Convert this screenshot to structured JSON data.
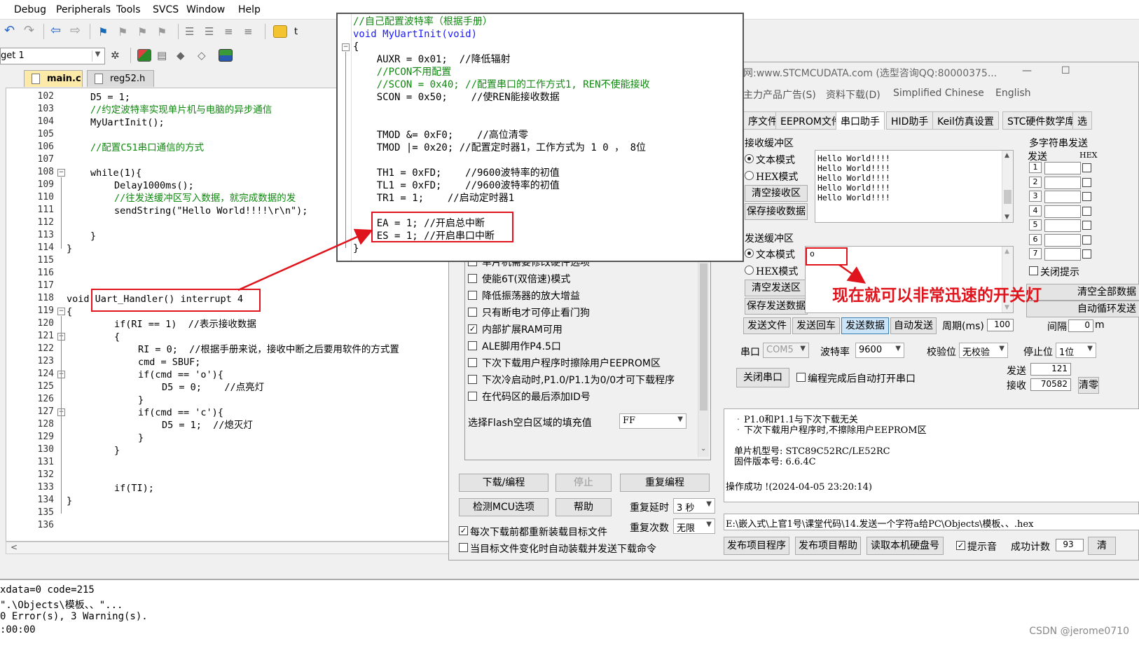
{
  "menu": [
    "Debug",
    "Peripherals",
    "Tools",
    "SVCS",
    "Window",
    "Help"
  ],
  "toolbar": {
    "tail_label": "t"
  },
  "target": {
    "label": "get 1"
  },
  "tabs": [
    "main.c",
    "reg52.h"
  ],
  "editor": {
    "lines": [
      {
        "n": "102",
        "t": "D5 = 1;"
      },
      {
        "n": "103",
        "t": "//约定波特率实现单片机与电脑的异步通信"
      },
      {
        "n": "104",
        "t": "MyUartInit();"
      },
      {
        "n": "105",
        "t": ""
      },
      {
        "n": "106",
        "t": "//配置C51串口通信的方式"
      },
      {
        "n": "107",
        "t": ""
      },
      {
        "n": "108",
        "t": "while(1){"
      },
      {
        "n": "109",
        "t": "Delay1000ms();"
      },
      {
        "n": "110",
        "t": "//往发送缓冲区写入数据，就完成数据的发"
      },
      {
        "n": "111",
        "t": "sendString(\"Hello World!!!!\\r\\n\");"
      },
      {
        "n": "112",
        "t": ""
      },
      {
        "n": "113",
        "t": "}"
      },
      {
        "n": "114",
        "t": "}"
      },
      {
        "n": "115",
        "t": ""
      },
      {
        "n": "116",
        "t": ""
      },
      {
        "n": "117",
        "t": ""
      },
      {
        "n": "118",
        "t": "void Uart_Handler() interrupt 4"
      },
      {
        "n": "119",
        "t": "{"
      },
      {
        "n": "120",
        "t": "if(RI == 1)  //表示接收数据"
      },
      {
        "n": "121",
        "t": "{"
      },
      {
        "n": "122",
        "t": "RI = 0;  //根据手册来说，接收中断之后要用软件的方式置"
      },
      {
        "n": "123",
        "t": "cmd = SBUF;"
      },
      {
        "n": "124",
        "t": "if(cmd == 'o'){"
      },
      {
        "n": "125",
        "t": "D5 = 0;    //点亮灯"
      },
      {
        "n": "126",
        "t": "}"
      },
      {
        "n": "127",
        "t": "if(cmd == 'c'){"
      },
      {
        "n": "128",
        "t": "D5 = 1;  //熄灭灯"
      },
      {
        "n": "129",
        "t": "}"
      },
      {
        "n": "130",
        "t": "}"
      },
      {
        "n": "131",
        "t": ""
      },
      {
        "n": "132",
        "t": ""
      },
      {
        "n": "133",
        "t": "if(TI);"
      },
      {
        "n": "134",
        "t": "}"
      },
      {
        "n": "135",
        "t": ""
      },
      {
        "n": "136",
        "t": ""
      }
    ]
  },
  "output": [
    "xdata=0 code=215",
    "\".\\Objects\\模板、、\"...",
    "0 Error(s), 3 Warning(s).",
    ":00:00"
  ],
  "watermark": "CSDN @jerome0710",
  "popup": {
    "lines": [
      "//自己配置波特率（根据手册）",
      "void MyUartInit(void)",
      "{",
      "    AUXR = 0x01;  //降低辐射",
      "    //PCON不用配置",
      "    //SCON = 0x40; //配置串口的工作方式1, REN不使能接收",
      "    SCON = 0x50;    //使REN能接收数据",
      "",
      "",
      "    TMOD &= 0xF0;    //高位清零",
      "    TMOD |= 0x20; //配置定时器1，工作方式为 1 0 ， 8位",
      "",
      "    TH1 = 0xFD;    //9600波特率的初值",
      "    TL1 = 0xFD;    //9600波特率的初值",
      "    TR1 = 1;    //启动定时器1",
      "",
      "    EA = 1; //开启总中断",
      "    ES = 1; //开启串口中断",
      "}"
    ]
  },
  "stc": {
    "title": "网:www.STCMCUDATA.com (选型咨询QQ:80000375...",
    "menu": [
      "主力产品广告(S)",
      "资料下载(D)",
      "Simplified Chinese",
      "English"
    ],
    "tabs": [
      "序文件",
      "EEPROM文件",
      "串口助手",
      "HID助手",
      "Keil仿真设置",
      "STC硬件数学库",
      "选"
    ],
    "recv_label": "接收缓冲区",
    "recv_text_mode": "文本模式",
    "recv_hex_mode": "HEX模式",
    "clear_recv": "清空接收区",
    "save_recv": "保存接收数据",
    "recv_lines": [
      "Hello World!!!!",
      "Hello World!!!!",
      "Hello World!!!!",
      "Hello World!!!!",
      "Hello World!!!!"
    ],
    "send_label": "发送缓冲区",
    "send_text_mode": "文本模式",
    "send_hex_mode": "HEX模式",
    "clear_send": "清空发送区",
    "save_send": "保存发送数据",
    "send_value": "o",
    "send_file": "发送文件",
    "send_cr": "发送回车",
    "send_data": "发送数据",
    "auto_send": "自动发送",
    "period_label": "周期(ms)",
    "period_value": "100",
    "multi_label": "多字符串发送",
    "multi_send": "发送",
    "multi_hex": "HEX",
    "multi_rows": [
      "1",
      "2",
      "3",
      "4",
      "5",
      "6",
      "7"
    ],
    "close_tip": "关闭提示",
    "clear_all": "清空全部数据",
    "auto_loop": "自动循环发送",
    "interval_label": "间隔",
    "interval_value": "0",
    "interval_unit": "m",
    "port_label": "串口",
    "port_value": "COM5",
    "baud_label": "波特率",
    "baud_value": "9600",
    "parity_label": "校验位",
    "parity_value": "无校验",
    "stop_label": "停止位",
    "stop_value": "1位",
    "close_port": "关闭串口",
    "auto_open": "编程完成后自动打开串口",
    "sent_label": "发送",
    "sent_value": "121",
    "recv_count_label": "接收",
    "recv_count_value": "70582",
    "clear_count": "清零",
    "options": [
      "单片机需要修改硬件选项",
      "使能6T(双倍速)模式",
      "降低振荡器的放大增益",
      "只有断电才可停止看门狗",
      "内部扩展RAM可用",
      "ALE脚用作P4.5口",
      "下次下载用户程序时擦除用户EEPROM区",
      "下次冷启动时,P1.0/P1.1为0/0才可下载程序",
      "在代码区的最后添加ID号"
    ],
    "fill_label": "选择Flash空白区域的填充值",
    "fill_value": "FF",
    "download": "下载/编程",
    "stop": "停止",
    "reprogram": "重复编程",
    "detect": "检测MCU选项",
    "help": "帮助",
    "retry_delay_label": "重复延时",
    "retry_delay_value": "3 秒",
    "retry_count_label": "重复次数",
    "retry_count_value": "无限",
    "reload_each": "每次下载前都重新装载目标文件",
    "auto_reload": "当目标文件变化时自动装载并发送下载命令",
    "log": [
      "P1.0和P1.1与下次下载无关",
      "下次下载用户程序时,不擦除用户EEPROM区",
      "单片机型号: STC89C52RC/LE52RC",
      "固件版本号: 6.6.4C",
      "操作成功 !(2024-04-05 23:20:14)"
    ],
    "file_path": "E:\\嵌入式\\上官1号\\课堂代码\\14.发送一个字符a给PC\\Objects\\模板、、.hex",
    "publish_prog": "发布项目程序",
    "publish_help": "发布项目帮助",
    "read_disk": "读取本机硬盘号",
    "beep": "提示音",
    "success_label": "成功计数",
    "success_value": "93",
    "clear_small": "清"
  },
  "annotation": "现在就可以非常迅速的开关灯"
}
